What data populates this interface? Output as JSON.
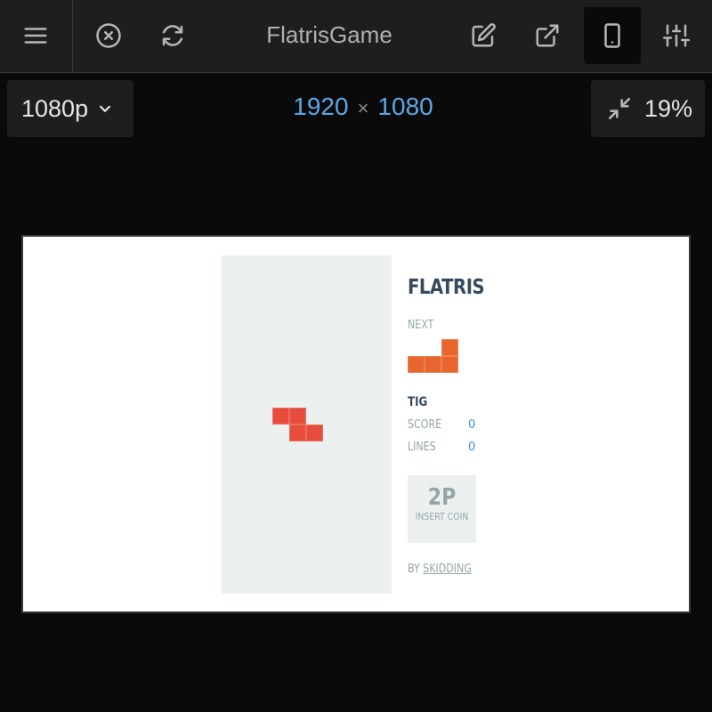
{
  "toolbar": {
    "title": "FlatrisGame",
    "icons": [
      "menu-icon",
      "close-circle-icon",
      "refresh-icon",
      "edit-icon",
      "external-link-icon",
      "mobile-device-icon",
      "settings-sliders-icon"
    ]
  },
  "device": {
    "resolution": "1080p",
    "width": "1920",
    "times": "×",
    "height": "1080",
    "zoom": "19%"
  },
  "game": {
    "title": "FLATRIS",
    "next_label": "NEXT",
    "player": "TIG",
    "score_label": "SCORE",
    "score": "0",
    "lines_label": "LINES",
    "lines": "0",
    "coin_title": "2P",
    "coin_subtitle": "INSERT COIN",
    "by_label": "BY",
    "author": "SKIDDING",
    "colors": {
      "active_piece": "#e74c3c",
      "next_piece": "#e8652e",
      "well": "#ecf0f1",
      "title": "#34495e",
      "value": "#3993d0"
    }
  }
}
